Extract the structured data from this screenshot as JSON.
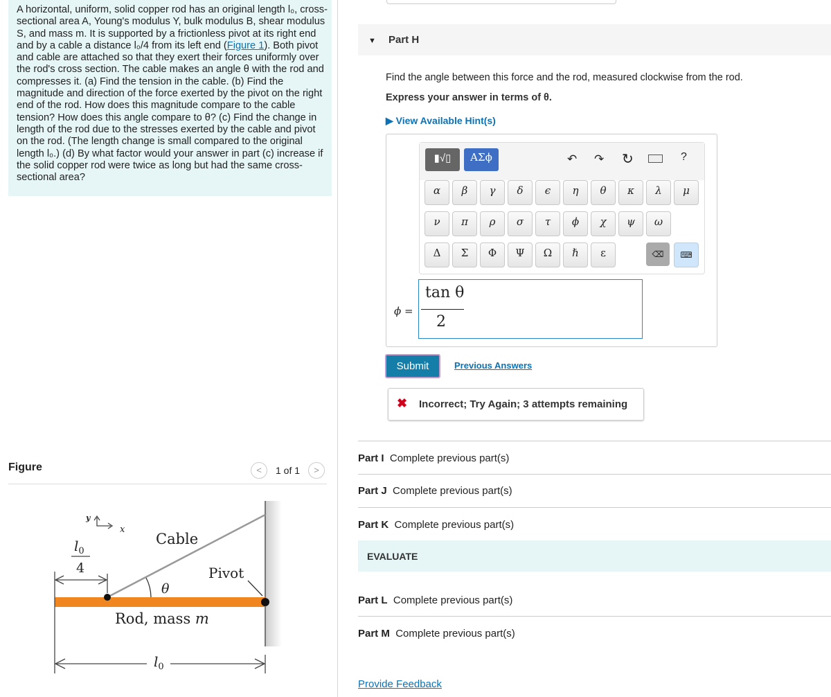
{
  "problem": {
    "text": "A horizontal, uniform, solid copper rod has an original length l₀, cross-sectional area A, Young's modulus Y, bulk modulus B, shear modulus S, and mass m. It is supported by a frictionless pivot at its right end and by a cable a distance l₀/4 from its left end (",
    "link": "Figure 1",
    "text2": "). Both pivot and cable are attached so that they exert their forces uniformly over the rod's cross section. The cable makes an angle θ with the rod and compresses it. (a) Find the tension in the cable. (b) Find the magnitude and direction of the force exerted by the pivot on the right end of the rod. How does this magnitude compare to the cable tension? How does this angle compare to θ? (c) Find the change in length of the rod due to the stresses exerted by the cable and pivot on the rod. (The length change is small compared to the original length l₀.) (d) By what factor would your answer in part (c) increase if the solid copper rod were twice as long but had the same cross-sectional area?"
  },
  "figure": {
    "title": "Figure",
    "pager": "1 of 1",
    "labels": {
      "y": "y",
      "x": "x",
      "cable": "Cable",
      "pivot": "Pivot",
      "theta": "θ",
      "rod": "Rod, mass ",
      "rod_m": "m",
      "l0": "l",
      "sub0": "0",
      "four": "4"
    },
    "rod_color": "#f0861f"
  },
  "part_h": {
    "label": "Part H",
    "question": "Find the angle between this force and the rod, measured clockwise from the rod.",
    "express": "Express your answer in terms of θ.",
    "hints": "View Available Hint(s)"
  },
  "keypad": {
    "tab1": "▮√▯",
    "tab2": "ΑΣϕ",
    "help": "?",
    "row1": [
      "α",
      "β",
      "γ",
      "δ",
      "ϵ",
      "η",
      "θ",
      "κ",
      "λ",
      "μ"
    ],
    "row2": [
      "ν",
      "π",
      "ρ",
      "σ",
      "τ",
      "ϕ",
      "χ",
      "ψ",
      "ω"
    ],
    "row3": [
      "Δ",
      "Σ",
      "Φ",
      "Ψ",
      "Ω",
      "ℏ",
      "ε"
    ]
  },
  "answer": {
    "lhs": "ϕ =",
    "num": "tan θ",
    "den": "2"
  },
  "submit": "Submit",
  "previous": "Previous Answers",
  "feedback": {
    "text": "Incorrect; Try Again; 3 attempts remaining",
    "color": "#d0021b"
  },
  "parts": [
    {
      "id": "Part I",
      "text": "Complete previous part(s)"
    },
    {
      "id": "Part J",
      "text": "Complete previous part(s)"
    },
    {
      "id": "Part K",
      "text": "Complete previous part(s)"
    },
    {
      "id": "Part L",
      "text": "Complete previous part(s)"
    },
    {
      "id": "Part M",
      "text": "Complete previous part(s)"
    }
  ],
  "evaluate": "EVALUATE",
  "provide_feedback": "Provide Feedback"
}
